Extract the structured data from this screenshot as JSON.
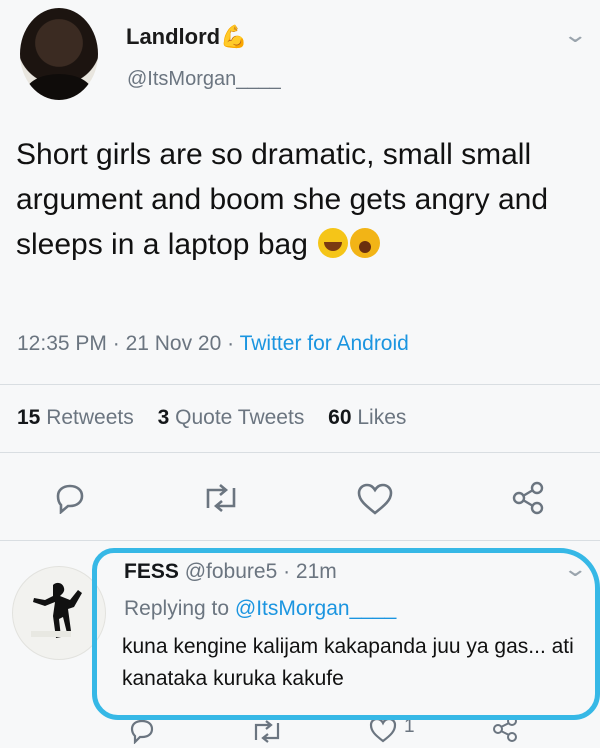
{
  "tweet": {
    "display_name": "Landlord",
    "verified_emoji": "💪",
    "handle": "@ItsMorgan____",
    "text": "Short girls are so dramatic, small small argument and boom she gets angry and sleeps in a laptop bag",
    "emojis": [
      "laughing-face",
      "crying-face"
    ],
    "time": "12:35 PM",
    "date": "21 Nov 20",
    "source": "Twitter for Android",
    "stats": {
      "retweets_count": "15",
      "retweets_label": "Retweets",
      "quotes_count": "3",
      "quotes_label": "Quote Tweets",
      "likes_count": "60",
      "likes_label": "Likes"
    },
    "actions": [
      "reply-icon",
      "retweet-icon",
      "like-icon",
      "share-icon"
    ]
  },
  "reply": {
    "display_name": "FESS",
    "handle": "@fobure5",
    "age": "21m",
    "replying_label": "Replying to",
    "replying_to": "@ItsMorgan____",
    "text": "kuna kengine kalijam kakapanda juu ya gas... ati kanataka kuruka kakufe",
    "likes": "1"
  },
  "colors": {
    "link": "#1b95e0",
    "highlight": "#36b8e6",
    "muted": "#6b7580"
  }
}
